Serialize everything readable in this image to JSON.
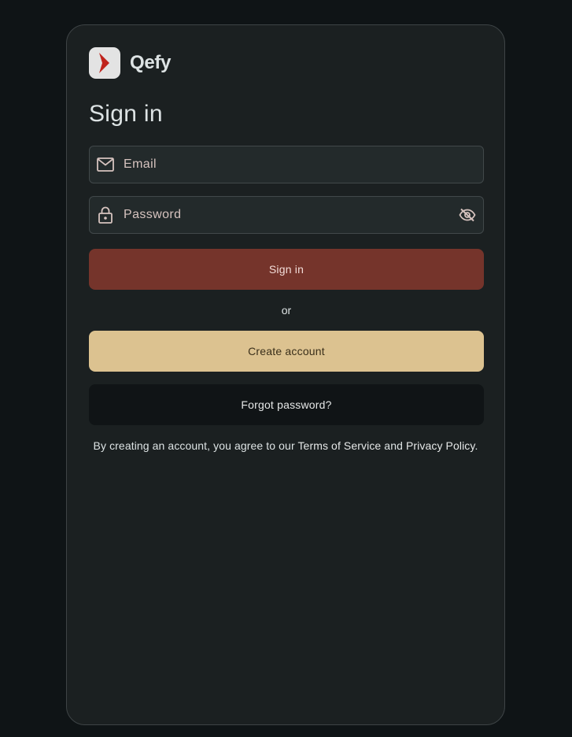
{
  "brand": {
    "name": "Qefy",
    "logo_icon": "chevron-right-logo-icon",
    "logo_color": "#c0241d"
  },
  "page": {
    "title": "Sign in"
  },
  "form": {
    "email": {
      "placeholder": "Email",
      "value": "",
      "icon": "mail-icon"
    },
    "password": {
      "placeholder": "Password",
      "value": "",
      "icon": "lock-icon",
      "toggle_icon": "eye-off-icon"
    }
  },
  "actions": {
    "sign_in_label": "Sign in",
    "or_label": "or",
    "create_account_label": "Create account",
    "forgot_password_label": "Forgot password?"
  },
  "legal": {
    "prefix": "By creating an account, you agree to our ",
    "terms_label": "Terms of Service",
    "conjunction": " and ",
    "privacy_label": "Privacy Policy",
    "suffix": "."
  },
  "colors": {
    "background": "#0f1416",
    "card": "#1b2021",
    "primary_button": "#75342b",
    "secondary_button": "#dcc290",
    "tertiary_button": "#101416"
  }
}
